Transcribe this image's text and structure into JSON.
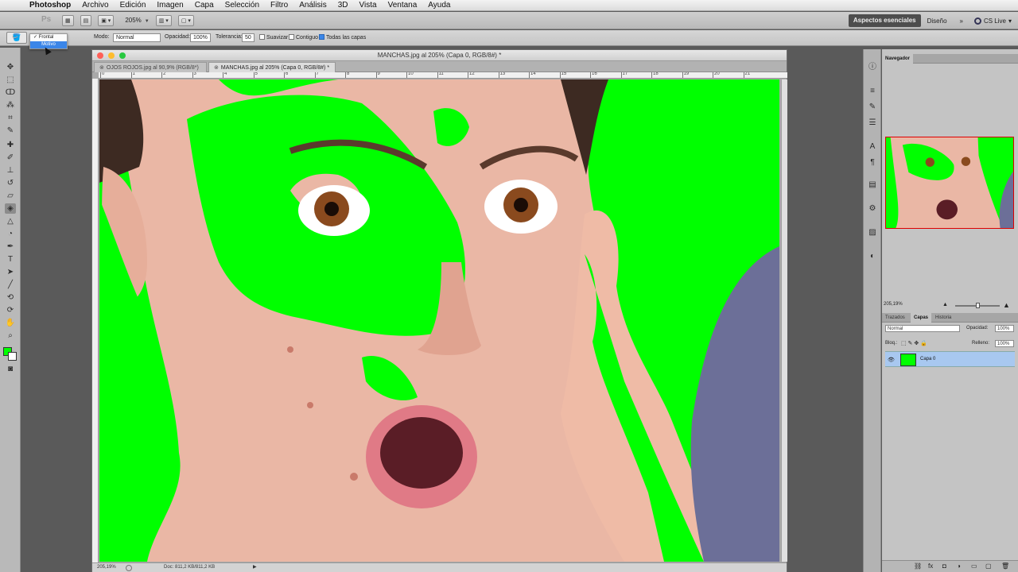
{
  "menubar": {
    "app_name": "Photoshop",
    "items": [
      "Archivo",
      "Edición",
      "Imagen",
      "Capa",
      "Selección",
      "Filtro",
      "Análisis",
      "3D",
      "Vista",
      "Ventana",
      "Ayuda"
    ]
  },
  "appbar": {
    "logo": "Ps",
    "zoom": "205%",
    "workspace_active": "Aspectos esenciales",
    "workspace_other": "Diseño",
    "more": "»",
    "cs_live": "CS Live"
  },
  "options": {
    "source_popup": [
      "Frontal",
      "Motivo"
    ],
    "source_checked": "✓",
    "mode_label": "Modo:",
    "mode_value": "Normal",
    "opacity_label": "Opacidad:",
    "opacity_value": "100%",
    "tolerance_label": "Tolerancia:",
    "tolerance_value": "50",
    "smooth_label": "Suavizar",
    "contiguous_label": "Contiguo",
    "all_layers_label": "Todas las capas"
  },
  "document": {
    "window_title": "MANCHAS.jpg al 205% (Capa 0, RGB/8#) *",
    "tabs": [
      {
        "label": "OJOS ROJOS.jpg al 90,9% (RGB/8*)"
      },
      {
        "label": "MANCHAS.jpg al 205% (Capa 0, RGB/8#)"
      }
    ],
    "ruler_labels": [
      "0",
      "1",
      "2",
      "3",
      "4",
      "5",
      "6",
      "7",
      "8",
      "9",
      "10",
      "11",
      "12",
      "13",
      "14",
      "15",
      "16",
      "17",
      "18",
      "19",
      "20",
      "21"
    ],
    "status_zoom": "205,19%",
    "status_doc": "Doc: 811,2 KB/811,2 KB"
  },
  "panels": {
    "navigator_tab": "Navegador",
    "navigator_zoom": "205,19%",
    "layers_tabs": [
      "Trazados",
      "Capas",
      "Historia"
    ],
    "layers_active_tab": "Capas",
    "blend_mode": "Normal",
    "opacity_label": "Opacidad:",
    "opacity_value": "100%",
    "lock_label": "Bloq.:",
    "fill_label": "Relleno:",
    "fill_value": "100%",
    "layer_name": "Capa 0"
  },
  "colors": {
    "foreground": "#00ff00",
    "background": "#ffffff",
    "fill_green": "#00ff00"
  }
}
